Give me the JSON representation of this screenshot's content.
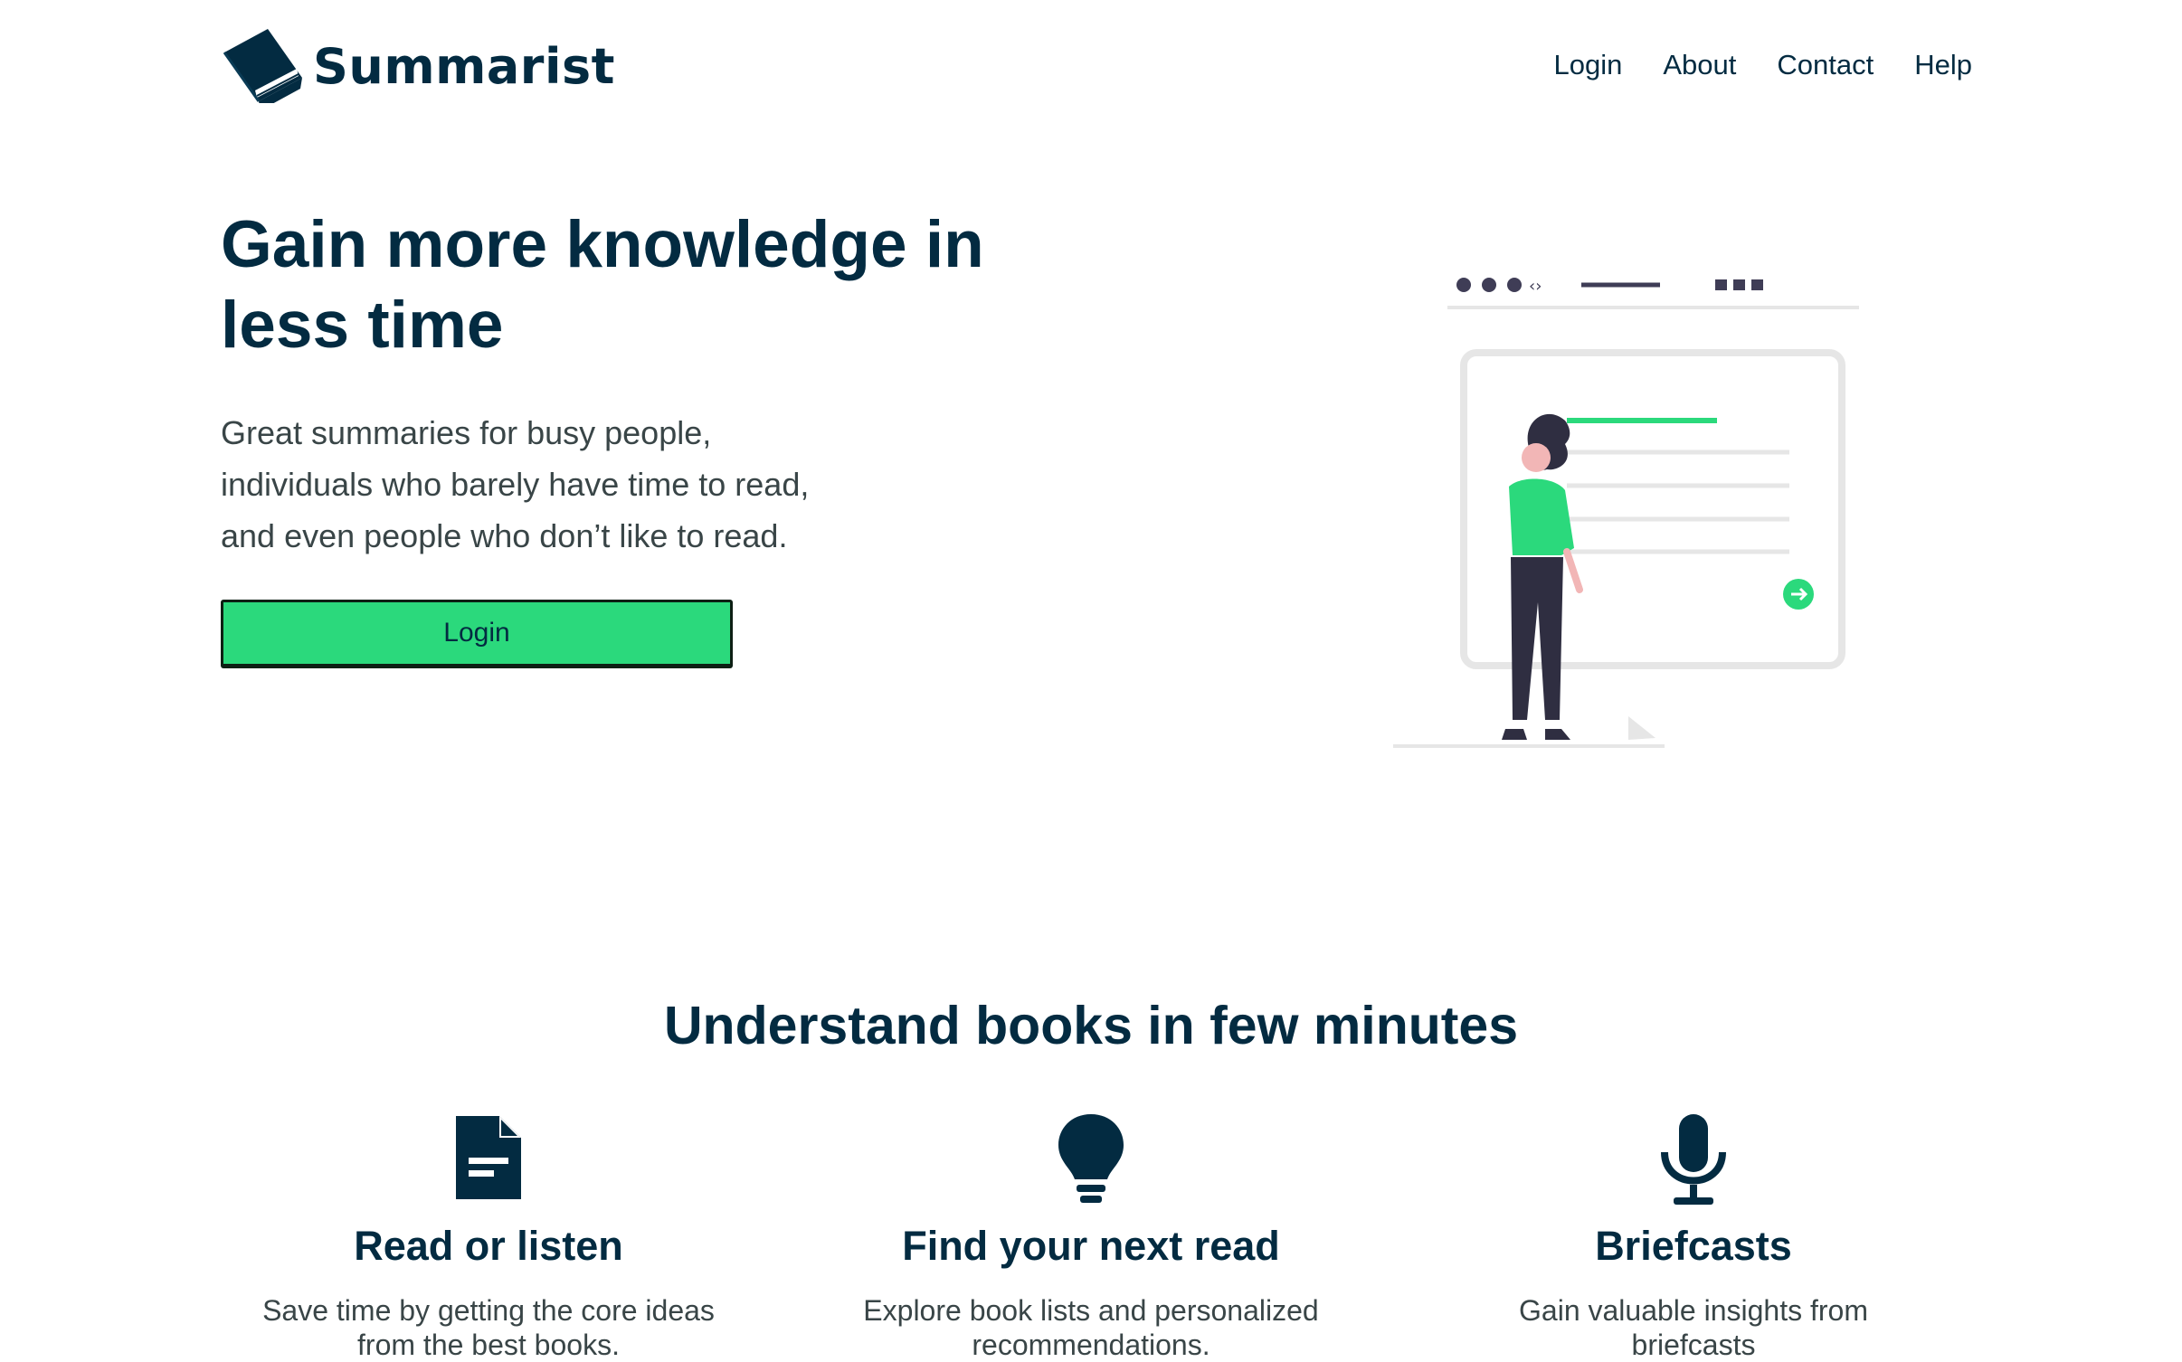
{
  "header": {
    "brand": "Summarist",
    "nav": [
      "Login",
      "About",
      "Contact",
      "Help"
    ]
  },
  "hero": {
    "title": "Gain more knowledge in less time",
    "subtitle": "Great summaries for busy people,\nindividuals who barely have time to read,\nand even people who don’t like to read.",
    "login_label": "Login"
  },
  "features": {
    "title": "Understand books in few minutes",
    "items": [
      {
        "icon": "document-icon",
        "title": "Read or listen",
        "text": "Save time by getting the core ideas from the best books."
      },
      {
        "icon": "lightbulb-icon",
        "title": "Find your next read",
        "text": "Explore book lists and personalized recommendations."
      },
      {
        "icon": "microphone-icon",
        "title": "Briefcasts",
        "text": "Gain valuable insights from briefcasts"
      }
    ]
  },
  "colors": {
    "primary": "#032b41",
    "accent": "#2bd97c",
    "text_secondary": "#394547"
  }
}
